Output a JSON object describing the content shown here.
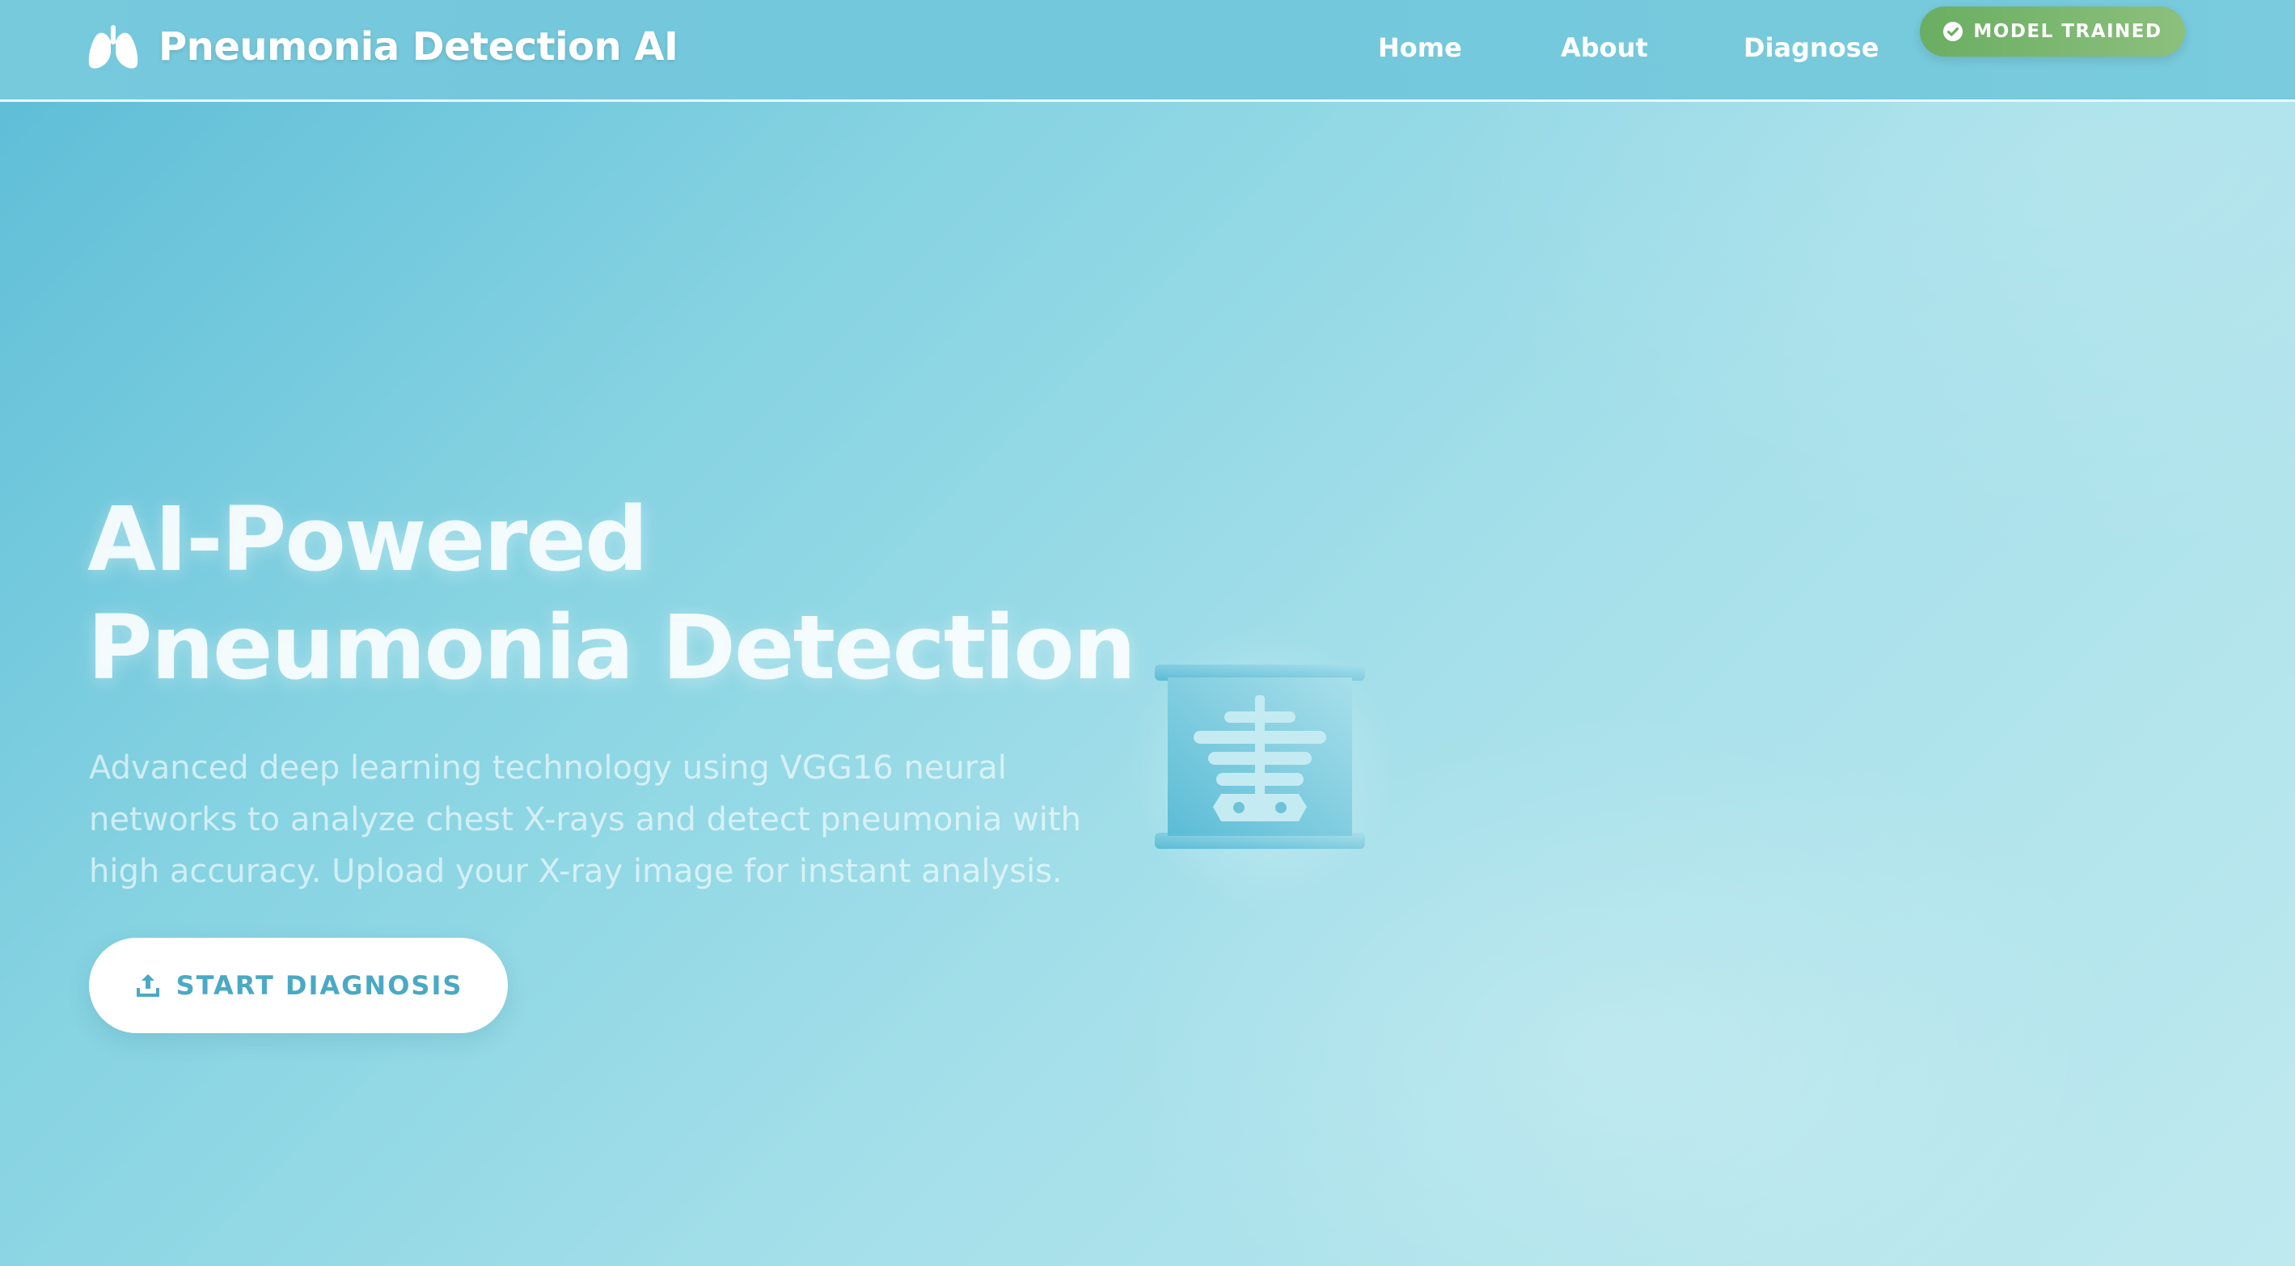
{
  "brand": {
    "title": "Pneumonia Detection AI",
    "icon": "lungs-icon"
  },
  "nav": {
    "items": [
      {
        "label": "Home"
      },
      {
        "label": "About"
      },
      {
        "label": "Diagnose"
      }
    ]
  },
  "status": {
    "label": "MODEL TRAINED",
    "icon": "check-circle-icon",
    "color": "#6aae62"
  },
  "hero": {
    "title_line1": "AI-Powered",
    "title_line2": "Pneumonia Detection",
    "description": "Advanced deep learning technology using VGG16 neural networks to analyze chest X-rays and detect pneumonia with high accuracy. Upload your X-ray image for instant analysis.",
    "cta_label": "START DIAGNOSIS",
    "cta_icon": "upload-icon",
    "illustration_icon": "x-ray-icon"
  },
  "colors": {
    "primary": "#5bbcd6",
    "accent": "#4aa9c4",
    "success": "#6aae62",
    "text_light": "#ffffff"
  }
}
